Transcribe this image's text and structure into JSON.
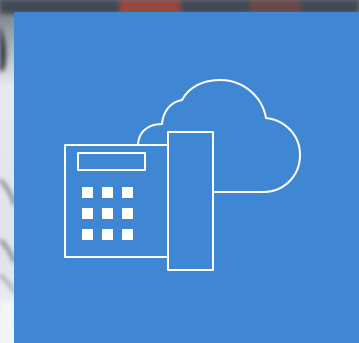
{
  "colors": {
    "panel_blue": "#3f87d2",
    "line_white": "#ffffff",
    "backdrop_light": "#e9ecef",
    "backdrop_dark": "#3a3f47",
    "backdrop_accent": "#b6473a"
  },
  "icons": {
    "main": "cloud-phone-icon",
    "phone": "desk-phone-icon",
    "cloud": "cloud-icon",
    "keypad": "keypad-icon",
    "display": "phone-display-icon",
    "handset": "handset-icon"
  },
  "keypad": {
    "rows": 3,
    "cols": 3
  }
}
